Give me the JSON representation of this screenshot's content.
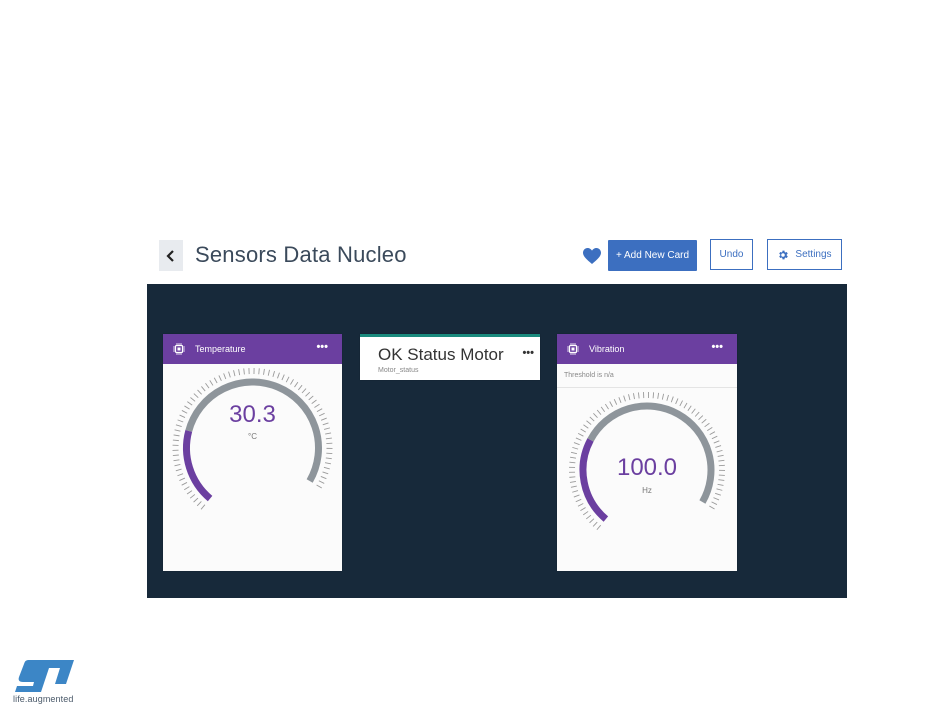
{
  "header": {
    "title": "Sensors Data Nucleo",
    "add_card_label": "+ Add New Card",
    "undo_label": "Undo",
    "settings_label": "Settings"
  },
  "cards": {
    "temperature": {
      "title": "Temperature",
      "menu": "•••",
      "value": "30.3",
      "unit": "°C",
      "fill_fraction": 0.25
    },
    "status": {
      "title": "OK Status Motor",
      "subtitle": "Motor_status",
      "menu": "•••"
    },
    "vibration": {
      "title": "Vibration",
      "menu": "•••",
      "threshold": "Threshold is n/a",
      "value": "100.0",
      "unit": "Hz",
      "fill_fraction": 0.3
    }
  },
  "logo": {
    "tagline": "life.augmented"
  },
  "colors": {
    "accent": "#6b3fa0",
    "primary_button": "#3c6fc0",
    "dashboard_bg": "#17293a",
    "status_bar": "#1a8a7d",
    "gauge_track": "#8e959b"
  },
  "icons": {
    "back": "chevron-left-icon",
    "favorite": "heart-icon",
    "settings": "gear-icon",
    "card": "chip-icon"
  }
}
